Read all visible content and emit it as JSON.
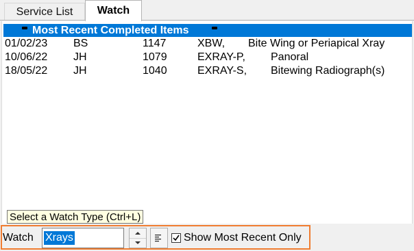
{
  "tabs": [
    {
      "label": "Service List",
      "active": false
    },
    {
      "label": "Watch",
      "active": true
    }
  ],
  "list": {
    "header": "Most Recent Completed Items",
    "rows": [
      {
        "date": "01/02/23",
        "provider": "BS",
        "number": "1147",
        "code": "XBW,",
        "description": "Bite Wing or Periapical Xray"
      },
      {
        "date": "10/06/22",
        "provider": "JH",
        "number": "1079",
        "code": "EXRAY-P,",
        "description": "Panoral"
      },
      {
        "date": "18/05/22",
        "provider": "JH",
        "number": "1040",
        "code": "EXRAY-S,",
        "description": "Bitewing Radiograph(s)"
      }
    ]
  },
  "tooltip": "Select a Watch Type (Ctrl+L)",
  "watch": {
    "label": "Watch",
    "value": "Xrays",
    "show_recent_label": "Show Most Recent Only",
    "show_recent_checked": true
  },
  "colors": {
    "highlight": "#0078d7",
    "focus_border": "#f07c30",
    "tooltip_bg": "#ffffe1"
  }
}
